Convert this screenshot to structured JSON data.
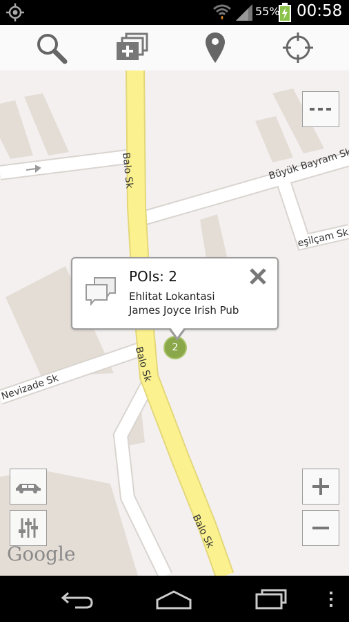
{
  "status": {
    "battery_pct": "55%",
    "clock": "00:58",
    "icons": [
      "gps-icon",
      "wifi-icon",
      "signal-icon",
      "battery-icon"
    ]
  },
  "toolbar": {
    "icons": [
      "search-icon",
      "add-layers-icon",
      "location-pin-icon",
      "crosshair-icon"
    ]
  },
  "map": {
    "streets": {
      "balo_top": "Balo Sk",
      "balo_mid": "Balo Sk",
      "balo_bottom": "Balo Sk",
      "buyuk_bayram": "Büyük Bayram Sk",
      "yesilcam": "eşilçam Sk",
      "nevizade": "Nevizade Sk"
    },
    "attribution": "Google",
    "cluster_count": "2"
  },
  "popup": {
    "title": "POIs: 2",
    "items": [
      "Ehlitat Lokantasi",
      "James Joyce Irish Pub"
    ]
  },
  "colors": {
    "main_road": "#fbf28f",
    "main_road_edge": "#e4d77a",
    "street": "#ffffff",
    "building": "#e2dbd4",
    "cluster": "#8aa84a"
  }
}
